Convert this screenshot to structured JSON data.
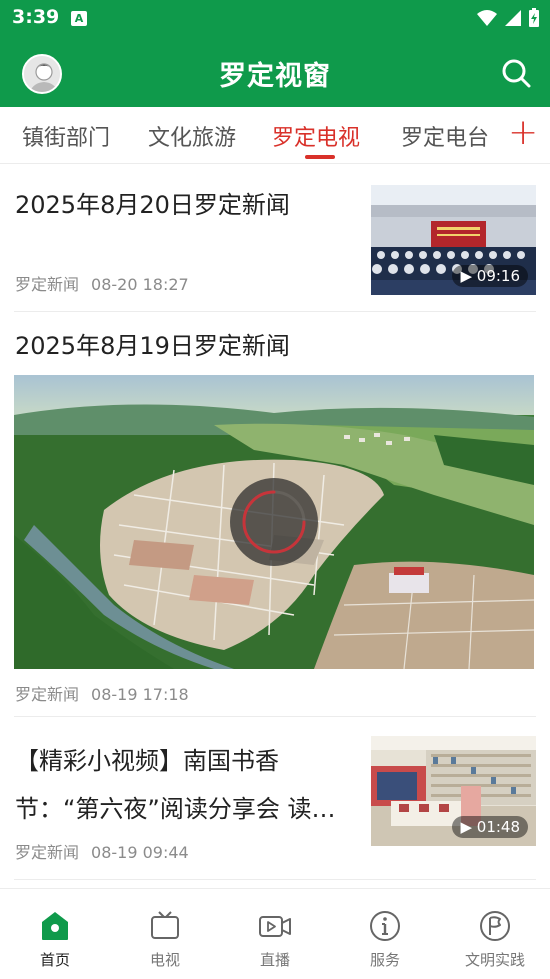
{
  "status_bar": {
    "time": "3:39",
    "notification_letter": "A"
  },
  "app_bar": {
    "title": "罗定视窗"
  },
  "tabs": [
    {
      "label": "镇街部门",
      "active": false
    },
    {
      "label": "文化旅游",
      "active": false
    },
    {
      "label": "罗定电视",
      "active": true
    },
    {
      "label": "罗定电台",
      "active": false
    }
  ],
  "add_tab_icon": "plus-icon",
  "feed": [
    {
      "title": "2025年8月20日罗定新闻",
      "source": "罗定新闻",
      "date": "08-20 18:27",
      "duration": "▶ 09:16"
    },
    {
      "title": "2025年8月19日罗定新闻",
      "source": "罗定新闻",
      "date": "08-19 17:18"
    },
    {
      "title_line1": "【精彩小视频】南国书香",
      "title_line2": "节：“第六夜”阅读分享会 读…",
      "source": "罗定新闻",
      "date": "08-19 09:44",
      "duration": "▶ 01:48"
    }
  ],
  "bottom_nav": [
    {
      "label": "首页",
      "icon": "home-icon",
      "active": true
    },
    {
      "label": "电视",
      "icon": "tv-icon",
      "active": false
    },
    {
      "label": "直播",
      "icon": "live-video-icon",
      "active": false
    },
    {
      "label": "服务",
      "icon": "info-icon",
      "active": false
    },
    {
      "label": "文明实践",
      "icon": "flag-circle-icon",
      "active": false
    }
  ],
  "colors": {
    "brand_green": "#0f9a4b",
    "accent_red": "#d9312a"
  }
}
